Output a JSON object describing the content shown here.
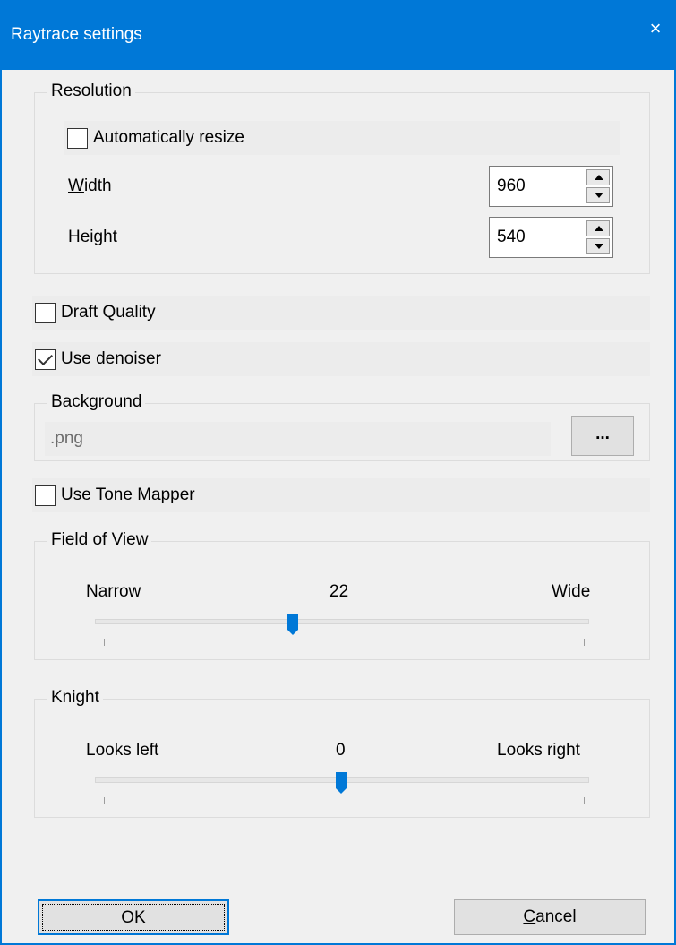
{
  "window": {
    "title": "Raytrace settings",
    "close_glyph": "×"
  },
  "resolution": {
    "group_label": "Resolution",
    "auto_resize_label": "Automatically resize",
    "auto_resize_checked": false,
    "width_label_mnemonic": "W",
    "width_label_rest": "idth",
    "width_value": "960",
    "height_label": "Height",
    "height_value": "540"
  },
  "draft_quality": {
    "label": "Draft Quality",
    "checked": false
  },
  "use_denoiser": {
    "label": "Use denoiser",
    "checked": true
  },
  "background": {
    "group_label": "Background",
    "file_value": ".png",
    "browse_label": "..."
  },
  "tone_mapper": {
    "label": "Use Tone Mapper",
    "checked": false
  },
  "field_of_view": {
    "group_label": "Field of View",
    "min_label": "Narrow",
    "max_label": "Wide",
    "value": "22",
    "slider_fraction": 0.4
  },
  "knight": {
    "group_label": "Knight",
    "min_label": "Looks left",
    "max_label": "Looks right",
    "value": "0",
    "slider_fraction": 0.5
  },
  "buttons": {
    "ok_mnemonic": "O",
    "ok_rest": "K",
    "cancel_mnemonic": "C",
    "cancel_rest": "ancel"
  },
  "colors": {
    "accent": "#0078d7",
    "dialog_bg": "#f0f0f0"
  },
  "icons": {
    "close": "close-icon",
    "spin_up": "spin-up-icon",
    "spin_down": "spin-down-icon",
    "check": "check-icon"
  }
}
